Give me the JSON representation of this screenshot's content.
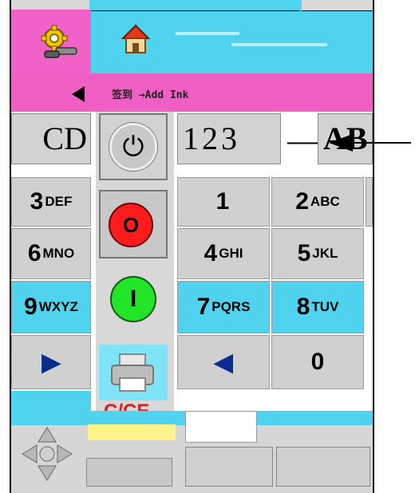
{
  "breadcrumb": {
    "text": "签到 →Add Ink"
  },
  "display": {
    "left": "CD",
    "center": "123",
    "separator": "—",
    "right": "AB"
  },
  "keypad": {
    "left": [
      {
        "digit": "3",
        "letters": "DEF"
      },
      {
        "digit": "6",
        "letters": "MNO"
      },
      {
        "digit": "9",
        "letters": "WXYZ"
      },
      {
        "digit": "▶",
        "letters": ""
      }
    ],
    "right": [
      {
        "digit": "1",
        "letters": ""
      },
      {
        "digit": "2",
        "letters": "ABC"
      },
      {
        "digit": "4",
        "letters": "GHI"
      },
      {
        "digit": "5",
        "letters": "JKL"
      },
      {
        "digit": "7",
        "letters": "PQRS"
      },
      {
        "digit": "8",
        "letters": "TUV"
      },
      {
        "digit": "◀",
        "letters": ""
      },
      {
        "digit": "0",
        "letters": ""
      }
    ]
  },
  "side_buttons": {
    "power": "⏻",
    "off": "O",
    "on": "I"
  },
  "clear_label": "C/CE",
  "colors": {
    "accent_cyan": "#4fd3ef",
    "accent_pink": "#f062c8",
    "off_red": "#ff1c1c",
    "on_green": "#22e52a"
  },
  "icons": [
    "gear-icon",
    "home-icon",
    "back-arrow-icon",
    "power-icon",
    "printer-icon",
    "dpad-icon",
    "pointer-arrow-icon"
  ]
}
